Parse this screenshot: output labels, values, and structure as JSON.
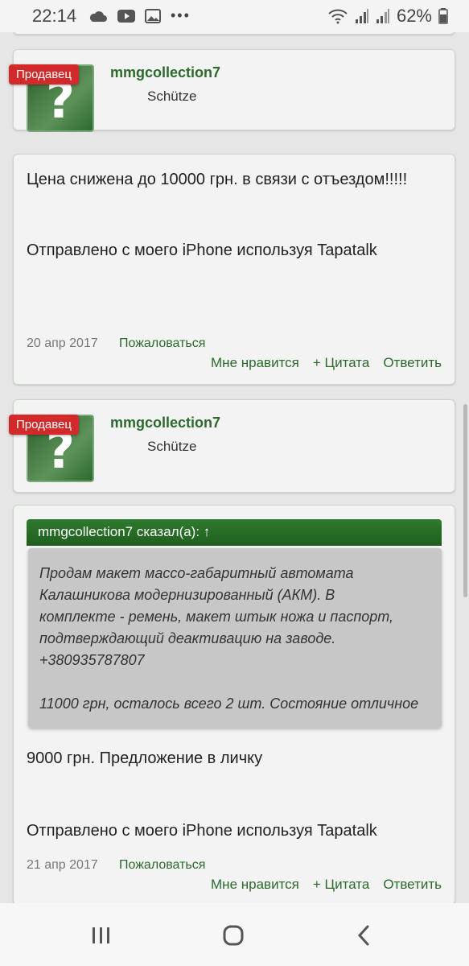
{
  "status_bar": {
    "time": "22:14",
    "left_icons": [
      "cloud-icon",
      "youtube-icon",
      "gallery-icon",
      "more-dots-icon"
    ],
    "right_icons": [
      "wifi-icon",
      "signal-icon",
      "signal-icon-2",
      "battery-icon"
    ],
    "battery": "62%"
  },
  "posts": [
    {
      "badge": "Продавец",
      "username": "mmgcollection7",
      "rank": "Schütze",
      "paragraphs": [
        "Цена снижена до 10000 грн. в связи с отъездом!!!!!",
        "Отправлено с моего iPhone используя Tapatalk"
      ],
      "date": "20 апр 2017",
      "report": "Пожаловаться",
      "actions": {
        "like": "Мне нравится",
        "quote": "+ Цитата",
        "reply": "Ответить"
      }
    },
    {
      "badge": "Продавец",
      "username": "mmgcollection7",
      "rank": "Schütze",
      "quote": {
        "header": "mmgcollection7 сказал(а): ↑",
        "lines": [
          "Продам макет массо-габаритный автомата",
          "Калашникова модернизированный (АКМ). В",
          "комплекте - ремень, макет штык ножа и паспорт,",
          "подтверждающий деактивацию на заводе.",
          "+380935787807",
          "",
          "11000 грн, осталось всего 2 шт. Состояние отличное"
        ]
      },
      "paragraphs": [
        "9000 грн. Предложение в личку",
        "Отправлено с моего iPhone используя Tapatalk"
      ],
      "date": "21 апр 2017",
      "report": "Пожаловаться",
      "actions": {
        "like": "Мне нравится",
        "quote": "+ Цитата",
        "reply": "Ответить"
      }
    }
  ],
  "nav_bar": [
    "recent-apps-icon",
    "home-icon",
    "back-icon"
  ]
}
